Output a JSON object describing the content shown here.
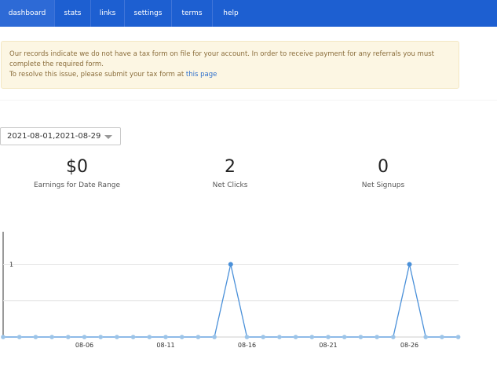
{
  "nav": {
    "items": [
      {
        "label": "dashboard",
        "active": true
      },
      {
        "label": "stats"
      },
      {
        "label": "links"
      },
      {
        "label": "settings"
      },
      {
        "label": "terms"
      },
      {
        "label": "help"
      }
    ]
  },
  "alert": {
    "line1": "Our records indicate we do not have a tax form on file for your account. In order to receive payment for any referrals you must complete the required form.",
    "line2_prefix": "To resolve this issue, please submit your tax form at",
    "link_text": "this page"
  },
  "date_range": {
    "value": "2021-08-01,2021-08-29"
  },
  "stats": {
    "earnings": {
      "value": "$0",
      "label": "Earnings for Date Range"
    },
    "clicks": {
      "value": "2",
      "label": "Net Clicks"
    },
    "signups": {
      "value": "0",
      "label": "Net Signups"
    }
  },
  "colors": {
    "nav_bg": "#1d5fd1",
    "alert_bg": "#fcf6e3",
    "alert_text": "#8a6d3b",
    "link": "#2f70cc",
    "series": "#4a90d9",
    "point": "#9cc4e8"
  },
  "chart_data": {
    "type": "line",
    "x": [
      "08-01",
      "08-02",
      "08-03",
      "08-04",
      "08-05",
      "08-06",
      "08-07",
      "08-08",
      "08-09",
      "08-10",
      "08-11",
      "08-12",
      "08-13",
      "08-14",
      "08-15",
      "08-16",
      "08-17",
      "08-18",
      "08-19",
      "08-20",
      "08-21",
      "08-22",
      "08-23",
      "08-24",
      "08-25",
      "08-26",
      "08-27",
      "08-28",
      "08-29"
    ],
    "series": [
      {
        "values": [
          0,
          0,
          0,
          0,
          0,
          0,
          0,
          0,
          0,
          0,
          0,
          0,
          0,
          0,
          1,
          0,
          0,
          0,
          0,
          0,
          0,
          0,
          0,
          0,
          0,
          1,
          0,
          0,
          0
        ]
      }
    ],
    "x_tick_labels": [
      "08-06",
      "08-11",
      "08-16",
      "08-21",
      "08-26"
    ],
    "y_tick_labels": [
      "1"
    ],
    "ylim": [
      0,
      1.2
    ],
    "grid": true
  }
}
